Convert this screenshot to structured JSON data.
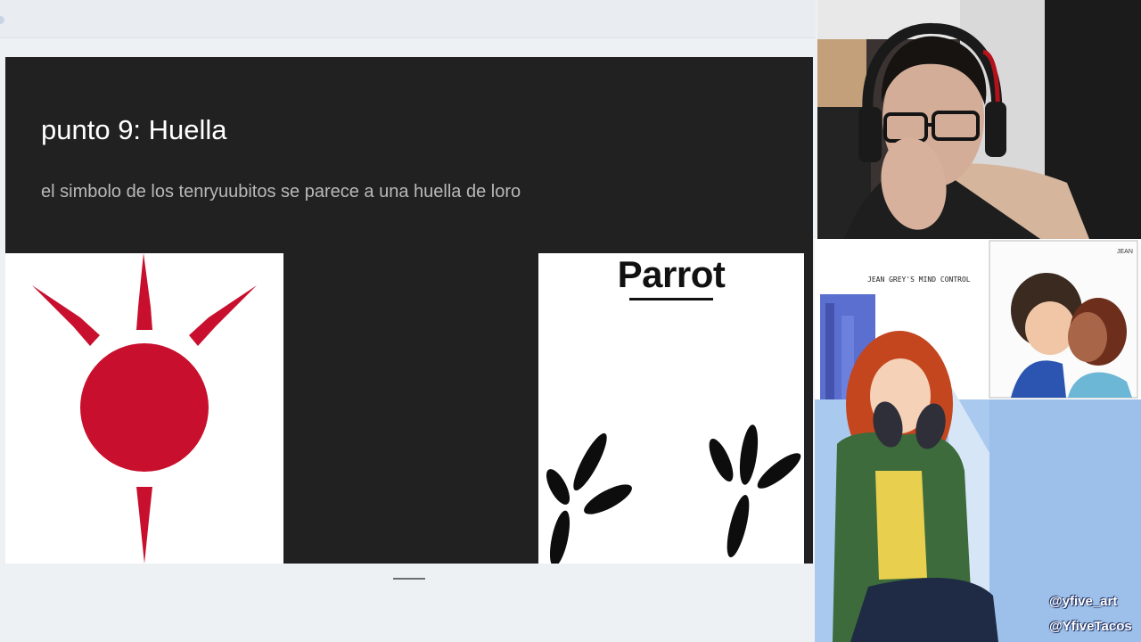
{
  "slide": {
    "title": "punto 9: Huella",
    "subtitle": "el simbolo de los tenryuubitos se parece a una huella de loro",
    "image_left": {
      "icon": "tenryuubito-symbol",
      "color": "#c8102e"
    },
    "image_right": {
      "label": "Parrot",
      "icon": "parrot-footprints"
    }
  },
  "comic": {
    "caption": "JEAN GREY'S MIND CONTROL",
    "inset_label": "JEAN",
    "watermarks": [
      "@yfive_art",
      "@YfiveTacos"
    ]
  },
  "colors": {
    "slide_bg": "#212121",
    "symbol_red": "#c8102e",
    "page_bg": "#eef1f4"
  }
}
